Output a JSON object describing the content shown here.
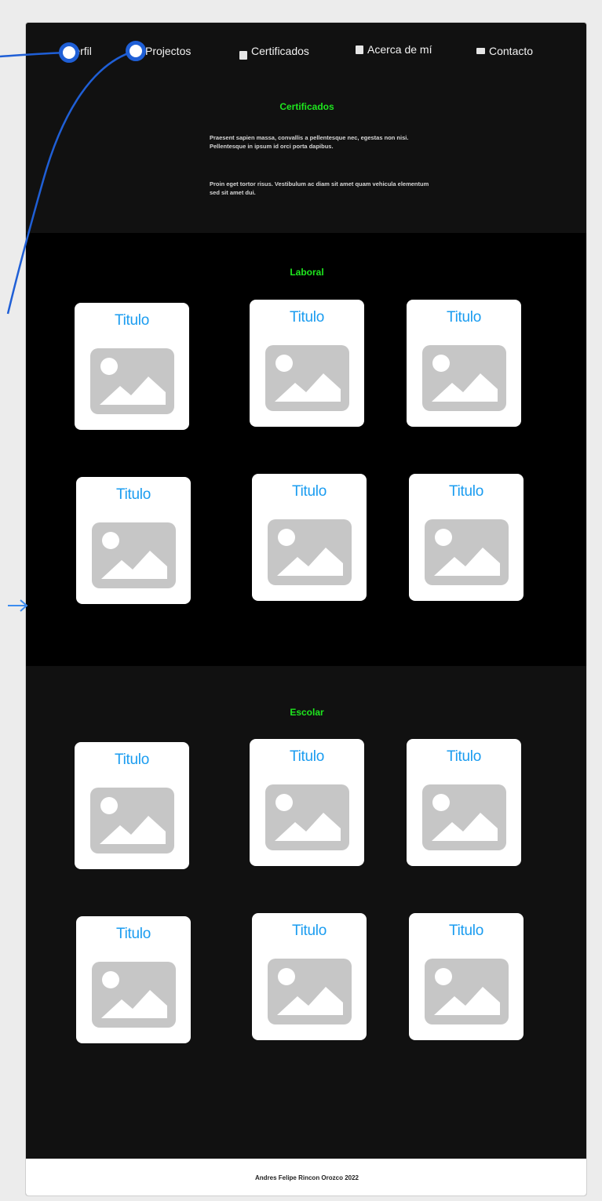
{
  "nav": {
    "items": [
      {
        "label": "Perfil",
        "icon": null
      },
      {
        "label": "Projectos",
        "icon": null
      },
      {
        "label": "Certificados",
        "icon": "certificate-icon"
      },
      {
        "label": "Acerca de mí",
        "icon": "document-icon"
      },
      {
        "label": "Contacto",
        "icon": "mail-icon"
      }
    ]
  },
  "hero": {
    "title": "Certificados",
    "paragraph_1": "Praesent sapien massa, convallis a pellentesque nec, egestas non nisi. Pellentesque in ipsum id orci porta dapibus.",
    "paragraph_2": "Proin eget tortor risus. Vestibulum ac diam sit amet quam vehicula elementum sed sit amet dui."
  },
  "sections": {
    "laboral": {
      "title": "Laboral",
      "cards": [
        {
          "title": "Titulo"
        },
        {
          "title": "Titulo"
        },
        {
          "title": "Titulo"
        },
        {
          "title": "Titulo"
        },
        {
          "title": "Titulo"
        },
        {
          "title": "Titulo"
        }
      ]
    },
    "escolar": {
      "title": "Escolar",
      "cards": [
        {
          "title": "Titulo"
        },
        {
          "title": "Titulo"
        },
        {
          "title": "Titulo"
        },
        {
          "title": "Titulo"
        },
        {
          "title": "Titulo"
        },
        {
          "title": "Titulo"
        }
      ]
    }
  },
  "footer": {
    "text": "Andres Felipe Rincon Orozco 2022"
  },
  "colors": {
    "accent_green": "#1ee61e",
    "card_title_blue": "#1a9cf0",
    "background_dark": "#111111",
    "section_black": "#000000",
    "prototype_link_blue": "#1f5fd6"
  }
}
